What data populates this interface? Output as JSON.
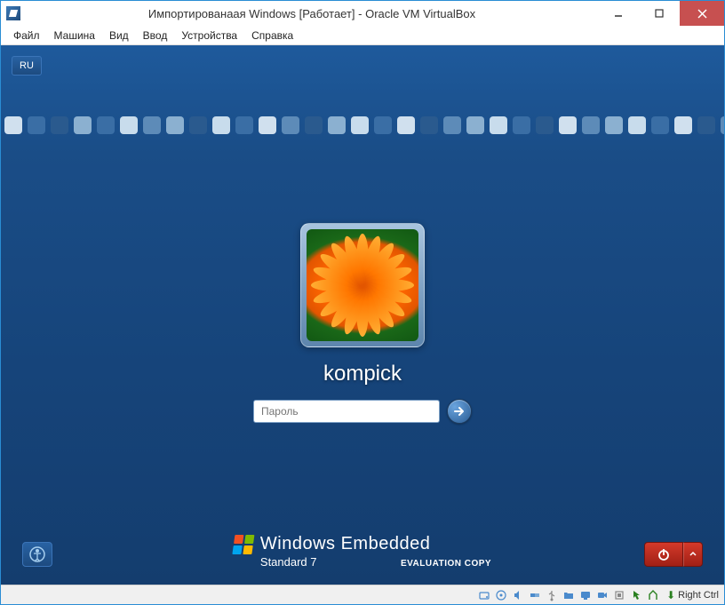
{
  "window": {
    "title": "Импортированаая Windows [Работает] - Oracle VM VirtualBox"
  },
  "menubar": {
    "items": [
      "Файл",
      "Машина",
      "Вид",
      "Ввод",
      "Устройства",
      "Справка"
    ]
  },
  "login": {
    "lang_indicator": "RU",
    "username": "kompick",
    "password_placeholder": "Пароль"
  },
  "branding": {
    "main": "Windows Embedded",
    "sub": "Standard 7",
    "eval": "EVALUATION COPY",
    "flag_colors": [
      "#f25022",
      "#7fba00",
      "#00a4ef",
      "#ffb900"
    ]
  },
  "statusbar": {
    "host_key": "Right Ctrl"
  },
  "icons": {
    "minimize": "minimize",
    "maximize": "maximize",
    "close": "close",
    "ease": "ease-of-access",
    "power": "power",
    "hd": "hard-disk",
    "cd": "optical-disk",
    "net": "network",
    "usb": "usb",
    "shared": "shared-folders",
    "display": "display",
    "audio": "audio",
    "rec": "recording",
    "cpu": "cpu",
    "mouse": "mouse-integration"
  },
  "squares_colors": [
    "#d0e0ee",
    "#3a6ea5",
    "#2a5a8e",
    "#8bb0d0",
    "#3a6ea5",
    "#c8dcec",
    "#5d8bb8",
    "#8bb0d0",
    "#2a5a8e",
    "#c8dcec",
    "#3a6ea5",
    "#d0e0ee",
    "#5d8bb8",
    "#2a5a8e",
    "#8bb0d0",
    "#c8dcec",
    "#3a6ea5",
    "#d0e0ee",
    "#2a5a8e",
    "#5d8bb8",
    "#8bb0d0",
    "#c8dcec",
    "#3a6ea5",
    "#2a5a8e",
    "#d0e0ee",
    "#5d8bb8",
    "#8bb0d0",
    "#c8dcec",
    "#3a6ea5",
    "#d0e0ee",
    "#2a5a8e",
    "#5d8bb8"
  ]
}
